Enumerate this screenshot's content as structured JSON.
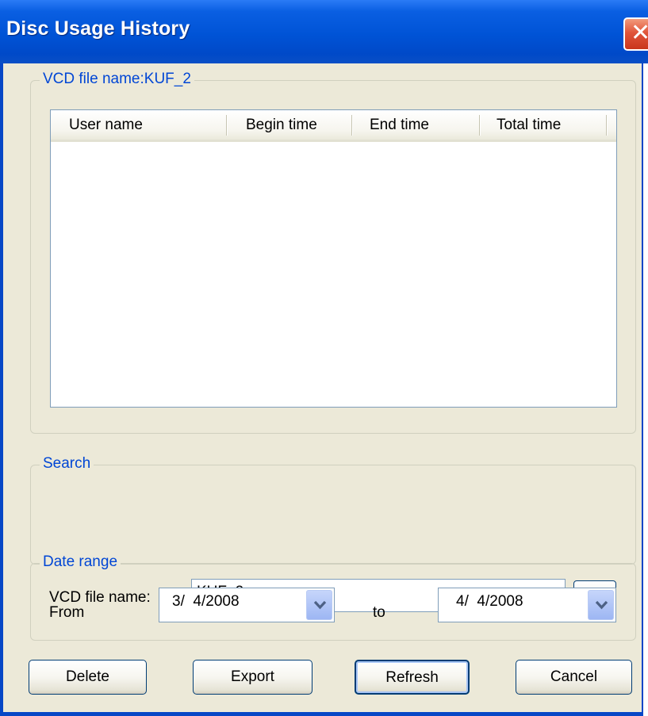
{
  "window": {
    "title": "Disc Usage History",
    "close_symbol": "✕"
  },
  "history_group": {
    "label": "VCD file name:KUF_2",
    "columns": [
      "User name",
      "Begin time",
      "End time",
      "Total time"
    ],
    "rows": []
  },
  "search_group": {
    "label": "Search",
    "field_label": "VCD file name:",
    "field_value": "KUF_2",
    "browse_label": "..."
  },
  "date_group": {
    "label": "Date range",
    "from_label": "From",
    "from_value": "3/  4/2008",
    "to_label": "to",
    "to_value": "4/  4/2008"
  },
  "buttons": {
    "delete": "Delete",
    "export": "Export",
    "refresh": "Refresh",
    "cancel": "Cancel"
  }
}
